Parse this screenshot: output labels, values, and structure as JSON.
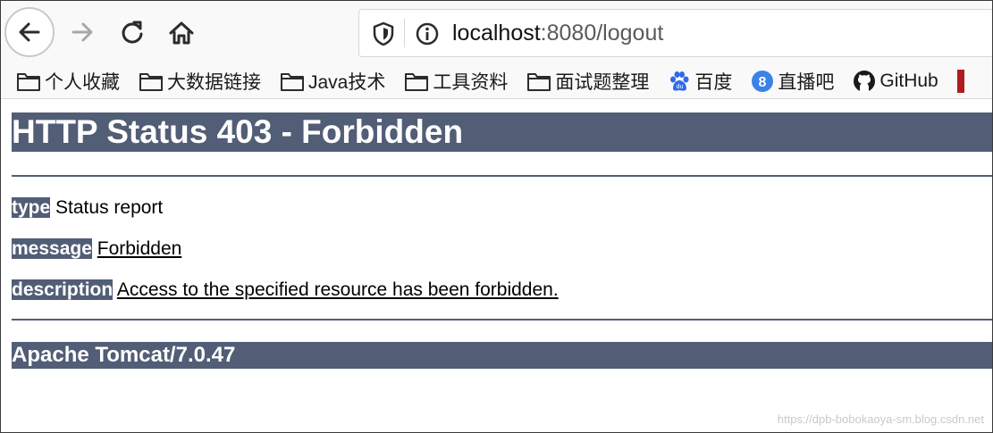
{
  "navbar": {
    "url": {
      "host": "localhost",
      "rest": ":8080/logout"
    }
  },
  "bookmarks": [
    {
      "label": "个人收藏",
      "icon": "folder-icon"
    },
    {
      "label": "大数据链接",
      "icon": "folder-icon"
    },
    {
      "label": "Java技术",
      "icon": "folder-icon"
    },
    {
      "label": "工具资料",
      "icon": "folder-icon"
    },
    {
      "label": "面试题整理",
      "icon": "folder-icon"
    },
    {
      "label": "百度",
      "icon": "baidu-paw-icon"
    },
    {
      "label": "直播吧",
      "icon": "zhibo8-icon"
    },
    {
      "label": "GitHub",
      "icon": "github-icon"
    }
  ],
  "page": {
    "title": "HTTP Status 403 - Forbidden",
    "type_label": "type",
    "type_value": "Status report",
    "message_label": "message",
    "message_value": "Forbidden",
    "description_label": "description",
    "description_value": "Access to the specified resource has been forbidden.",
    "server": "Apache Tomcat/7.0.47"
  },
  "watermark": "https://dpb-bobokaoya-sm.blog.csdn.net",
  "colors": {
    "tomcat_header": "#525d76",
    "nav_bg": "#f9f9fa"
  }
}
